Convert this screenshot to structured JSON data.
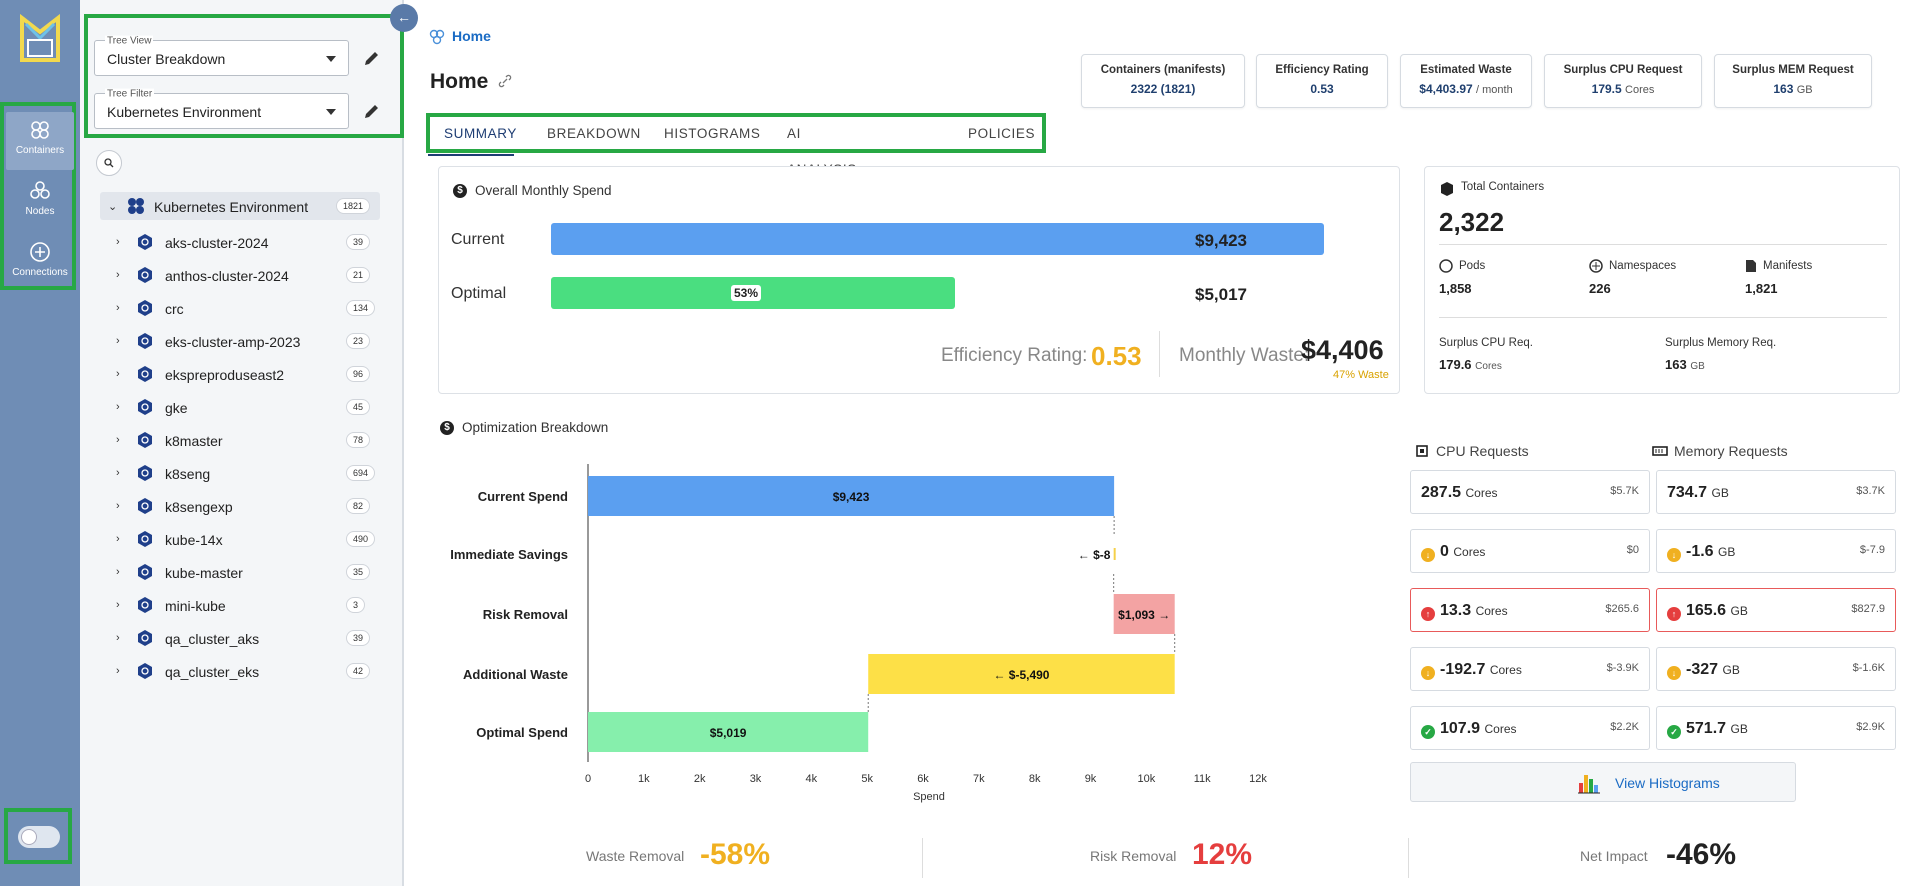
{
  "rail": {
    "items": [
      {
        "label": "Containers"
      },
      {
        "label": "Nodes"
      },
      {
        "label": "Connections"
      }
    ]
  },
  "tree": {
    "view_label": "Tree View",
    "view_value": "Cluster Breakdown",
    "filter_label": "Tree Filter",
    "filter_value": "Kubernetes Environment",
    "root": {
      "name": "Kubernetes Environment",
      "count": "1821"
    },
    "clusters": [
      {
        "name": "aks-cluster-2024",
        "count": "39"
      },
      {
        "name": "anthos-cluster-2024",
        "count": "21"
      },
      {
        "name": "crc",
        "count": "134"
      },
      {
        "name": "eks-cluster-amp-2023",
        "count": "23"
      },
      {
        "name": "ekspreproduseast2",
        "count": "96"
      },
      {
        "name": "gke",
        "count": "45"
      },
      {
        "name": "k8master",
        "count": "78"
      },
      {
        "name": "k8seng",
        "count": "694"
      },
      {
        "name": "k8sengexp",
        "count": "82"
      },
      {
        "name": "kube-14x",
        "count": "490"
      },
      {
        "name": "kube-master",
        "count": "35"
      },
      {
        "name": "mini-kube",
        "count": "3"
      },
      {
        "name": "qa_cluster_aks",
        "count": "39"
      },
      {
        "name": "qa_cluster_eks",
        "count": "42"
      }
    ]
  },
  "header": {
    "breadcrumb": "Home",
    "title": "Home",
    "kpis": [
      {
        "label": "Containers (manifests)",
        "value": "2322 (1821)",
        "unit": ""
      },
      {
        "label": "Efficiency Rating",
        "value": "0.53",
        "unit": ""
      },
      {
        "label": "Estimated Waste",
        "value": "$4,403.97",
        "unit": "/ month"
      },
      {
        "label": "Surplus CPU Request",
        "value": "179.5",
        "unit": "Cores"
      },
      {
        "label": "Surplus MEM Request",
        "value": "163",
        "unit": "GB"
      }
    ]
  },
  "tabs": [
    "SUMMARY",
    "BREAKDOWN",
    "HISTOGRAMS",
    "AI ANALYSIS DETAILS",
    "POLICIES"
  ],
  "spend": {
    "title": "Overall Monthly Spend",
    "current_label": "Current",
    "current_value": "$9,423",
    "optimal_label": "Optimal",
    "optimal_value": "$5,017",
    "optimal_pct": "53%",
    "current_fraction": 1.0,
    "optimal_fraction": 0.53,
    "efficiency_label": "Efficiency Rating:",
    "efficiency_value": "0.53",
    "waste_label": "Monthly Waste:",
    "waste_value": "$4,406",
    "waste_pct": "47% Waste"
  },
  "totals": {
    "title": "Total Containers",
    "value": "2,322",
    "pods_label": "Pods",
    "pods": "1,858",
    "ns_label": "Namespaces",
    "ns": "226",
    "manifests_label": "Manifests",
    "manifests": "1,821",
    "cpu_label": "Surplus CPU Req.",
    "cpu": "179.6",
    "cpu_unit": "Cores",
    "mem_label": "Surplus Memory Req.",
    "mem": "163",
    "mem_unit": "GB"
  },
  "optimization": {
    "title": "Optimization Breakdown"
  },
  "chart_data": {
    "type": "bar",
    "subtype": "waterfall",
    "orientation": "horizontal",
    "categories": [
      "Current Spend",
      "Immediate Savings",
      "Risk Removal",
      "Additional Waste",
      "Optimal Spend"
    ],
    "starts": [
      0,
      9423,
      9415,
      10508,
      0
    ],
    "ends": [
      9423,
      9415,
      10508,
      5019,
      5019
    ],
    "data_labels": [
      "$9,423",
      "← $-8",
      "$1,093 →",
      "← $-5,490",
      "$5,019"
    ],
    "colors": [
      "#5b9ff0",
      "#f5d04a",
      "#f3a3a3",
      "#fde047",
      "#86efac"
    ],
    "xlabel": "Spend",
    "xlim": [
      0,
      12000
    ],
    "xticks": [
      "0",
      "1k",
      "2k",
      "3k",
      "4k",
      "5k",
      "6k",
      "7k",
      "8k",
      "9k",
      "10k",
      "11k",
      "12k"
    ]
  },
  "resources": {
    "cpu_title": "CPU Requests",
    "mem_title": "Memory Requests",
    "rows": [
      {
        "status": "none",
        "cpu": "287.5",
        "cpu_unit": "Cores",
        "cpu_cost": "$5.7K",
        "mem": "734.7",
        "mem_unit": "GB",
        "mem_cost": "$3.7K"
      },
      {
        "status": "warn",
        "cpu": "0",
        "cpu_unit": "Cores",
        "cpu_cost": "$0",
        "mem": "-1.6",
        "mem_unit": "GB",
        "mem_cost": "$-7.9"
      },
      {
        "status": "risk",
        "cpu": "13.3",
        "cpu_unit": "Cores",
        "cpu_cost": "$265.6",
        "mem": "165.6",
        "mem_unit": "GB",
        "mem_cost": "$827.9"
      },
      {
        "status": "warn",
        "cpu": "-192.7",
        "cpu_unit": "Cores",
        "cpu_cost": "$-3.9K",
        "mem": "-327",
        "mem_unit": "GB",
        "mem_cost": "$-1.6K"
      },
      {
        "status": "ok",
        "cpu": "107.9",
        "cpu_unit": "Cores",
        "cpu_cost": "$2.2K",
        "mem": "571.7",
        "mem_unit": "GB",
        "mem_cost": "$2.9K"
      }
    ],
    "view_histograms": "View Histograms"
  },
  "summary": {
    "waste_label": "Waste Removal",
    "waste_value": "-58%",
    "risk_label": "Risk Removal",
    "risk_value": "12%",
    "net_label": "Net Impact",
    "net_value": "-46%"
  },
  "colors": {
    "accent": "#1e3d73",
    "waste": "#f0b020",
    "risk": "#e53e3e",
    "highlight": "#27a844"
  }
}
